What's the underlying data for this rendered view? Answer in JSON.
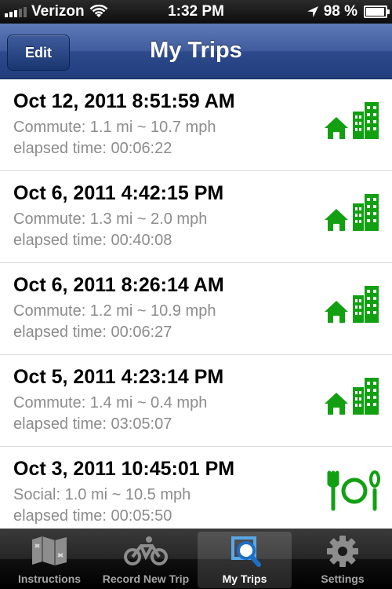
{
  "status": {
    "carrier": "Verizon",
    "time": "1:32 PM",
    "battery": "98 %"
  },
  "nav": {
    "edit_label": "Edit",
    "title": "My Trips"
  },
  "trips": [
    {
      "date": "Oct 12, 2011 8:51:59 AM",
      "detail": "Commute: 1.1 mi ~ 10.7 mph",
      "elapsed": "elapsed time: 00:06:22",
      "icon": "commute-icon"
    },
    {
      "date": "Oct 6, 2011 4:42:15 PM",
      "detail": "Commute: 1.3 mi ~ 2.0 mph",
      "elapsed": "elapsed time: 00:40:08",
      "icon": "commute-icon"
    },
    {
      "date": "Oct 6, 2011 8:26:14 AM",
      "detail": "Commute: 1.2 mi ~ 10.9 mph",
      "elapsed": "elapsed time: 00:06:27",
      "icon": "commute-icon"
    },
    {
      "date": "Oct 5, 2011 4:23:14 PM",
      "detail": "Commute: 1.4 mi ~ 0.4 mph",
      "elapsed": "elapsed time: 03:05:07",
      "icon": "commute-icon"
    },
    {
      "date": "Oct 3, 2011 10:45:01 PM",
      "detail": "Social: 1.0 mi ~ 10.5 mph",
      "elapsed": "elapsed time: 00:05:50",
      "icon": "social-icon"
    }
  ],
  "tabs": [
    {
      "label": "Instructions",
      "icon": "map-icon"
    },
    {
      "label": "Record New Trip",
      "icon": "bicycle-icon"
    },
    {
      "label": "My Trips",
      "icon": "magnifier-icon",
      "active": true
    },
    {
      "label": "Settings",
      "icon": "gear-icon"
    }
  ],
  "colors": {
    "icon_green": "#12a012",
    "nav_blue": "#2d4a8c"
  }
}
